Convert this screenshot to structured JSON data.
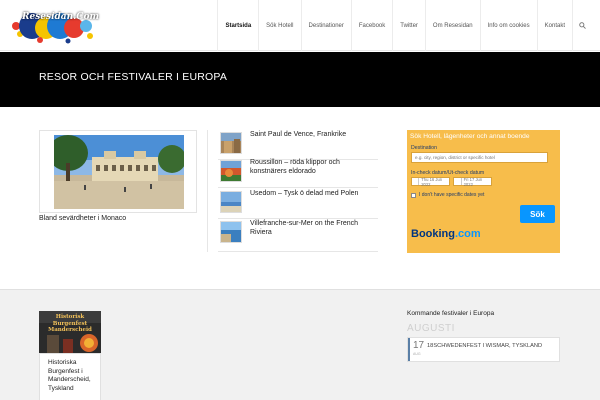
{
  "header": {
    "logo_text": "Resesidan.Com",
    "nav": [
      "Startsida",
      "Sök Hotell",
      "Destinationer",
      "Facebook",
      "Twitter",
      "Om Resesidan",
      "Info om cookies",
      "Kontakt"
    ],
    "active_index": 0
  },
  "page": {
    "title": "RESOR OCH FESTIVALER I EUROPA"
  },
  "featured": {
    "caption": "Bland sevärdheter i Monaco"
  },
  "articles": [
    {
      "title": "Saint Paul de Vence, Frankrike"
    },
    {
      "title": "Roussillon – röda klippor och konstnärers eldorado"
    },
    {
      "title": "Usedom – Tysk ö delad med Polen"
    },
    {
      "title": "Villefranche-sur-Mer on the French Riviera"
    }
  ],
  "booking": {
    "heading": "Sök Hotell, lägenheter och annat boende",
    "destination_label": "Destination",
    "destination_placeholder": "e.g. city, region, district or specific hotel",
    "dates_label": "In-check datum/Ut-check datum",
    "checkin": "Thu 16 Jun 2022",
    "checkout": "Fri 17 Jun 2022",
    "no_dates_label": "I don't have specific dates yet",
    "search_button": "Sök",
    "brand_a": "Booking",
    "brand_b": ".com"
  },
  "bottom": {
    "festival_image_text": "Historisk Burgenfest Manderscheid",
    "festival_title": "Historiska Burgenfest i Manderscheid, Tyskland",
    "upcoming_title": "Kommande festivaler i Europa",
    "month": "AUGUSTI",
    "event": {
      "day": "17",
      "dow": "AUG",
      "name": "18SCHWEDENFEST I WISMAR, TYSKLAND"
    }
  },
  "colors": {
    "booking_bg": "#f7bd4b",
    "booking_button": "#0896ff",
    "title_band": "#000000"
  }
}
